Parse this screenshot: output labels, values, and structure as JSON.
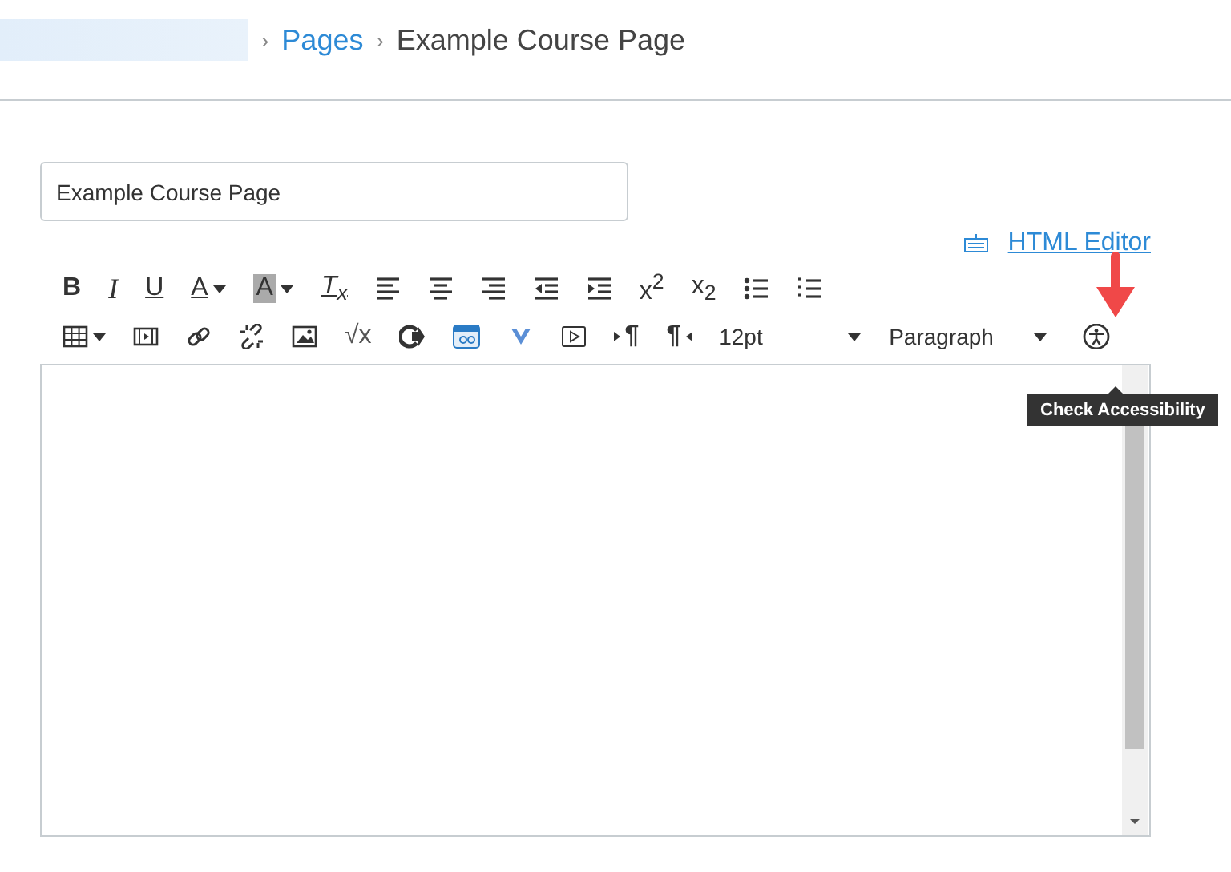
{
  "breadcrumb": [
    {
      "separator": "›",
      "label": "Pages",
      "kind": "link"
    },
    {
      "separator": "›",
      "label": "Example Course Page",
      "kind": "current"
    }
  ],
  "title_field": {
    "value": "Example Course Page"
  },
  "html_editor_link": {
    "label": "HTML Editor"
  },
  "toolbar_rows": [
    [
      {
        "kind": "glyph",
        "text": "B"
      },
      {
        "kind": "glyph",
        "text": "I"
      },
      {
        "kind": "glyph",
        "text": "U"
      },
      {
        "kind": "glyph",
        "text": "A"
      },
      {
        "kind": "glyph",
        "text": "A"
      },
      {
        "kind": "glyph",
        "text": "T$_{x}$"
      },
      {
        "kind": "icon"
      },
      {
        "kind": "icon"
      },
      {
        "kind": "icon"
      },
      {
        "kind": "icon"
      },
      {
        "kind": "icon"
      },
      {
        "kind": "glyph",
        "text": "x$^{2}$"
      },
      {
        "kind": "glyph",
        "text": "x$_{2}$"
      },
      {
        "kind": "icon"
      },
      {
        "kind": "icon"
      }
    ],
    [
      {
        "kind": "icon"
      },
      {
        "kind": "icon"
      },
      {
        "kind": "icon"
      },
      {
        "kind": "icon"
      },
      {
        "kind": "icon"
      },
      {
        "kind": "glyph",
        "text": "√x"
      },
      {
        "kind": "icon"
      },
      {
        "kind": "icon"
      },
      {
        "kind": "icon"
      },
      {
        "kind": "icon"
      },
      {
        "kind": "glyph",
        "text": "¶"
      },
      {
        "kind": "glyph",
        "text": "¶"
      },
      {
        "kind": "select",
        "text": "12pt"
      },
      {
        "kind": "select",
        "text": "Paragraph"
      },
      {
        "kind": "icon"
      }
    ]
  ],
  "tooltip": {
    "text": "Check Accessibility"
  }
}
